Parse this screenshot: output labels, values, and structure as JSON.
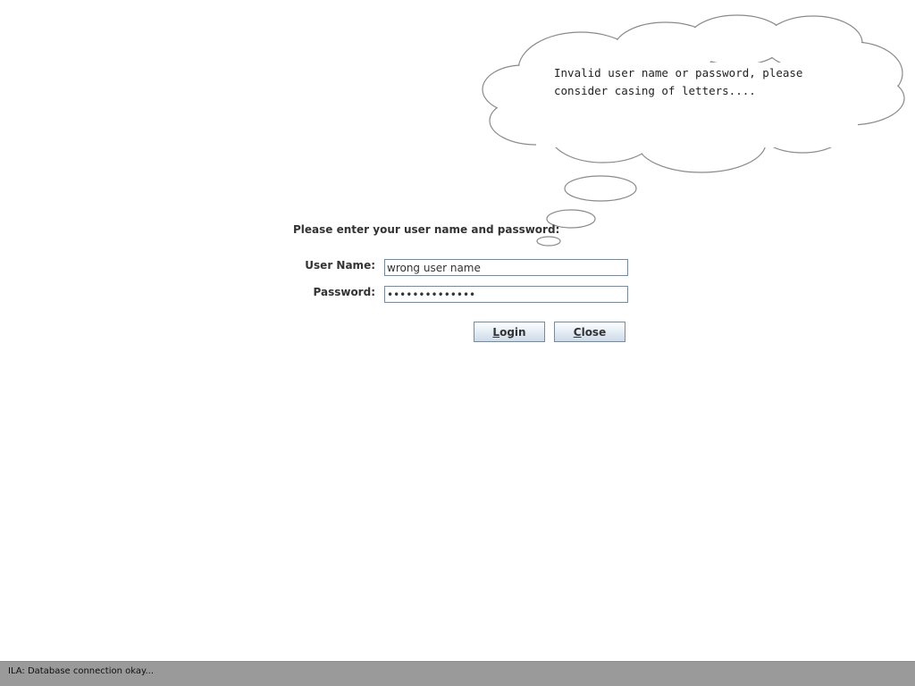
{
  "thought_bubble": {
    "message": "Invalid user name or password, please\nconsider casing of letters...."
  },
  "login_form": {
    "prompt": "Please enter your user name and password:",
    "username_label": "User Name:",
    "username_value": "wrong user name",
    "password_label": "Password:",
    "password_value": "wrongpassword1",
    "login_button": {
      "mnemonic": "L",
      "rest": "ogin"
    },
    "close_button": {
      "mnemonic": "C",
      "rest": "lose"
    }
  },
  "status_bar": {
    "text": "ILA: Database connection okay..."
  },
  "colors": {
    "background": "#ffffff",
    "status_bar": "#9a9a9a",
    "button_gradient_top": "#ffffff",
    "button_gradient_bottom": "#cfdbe8",
    "field_border": "#7a8a99"
  }
}
